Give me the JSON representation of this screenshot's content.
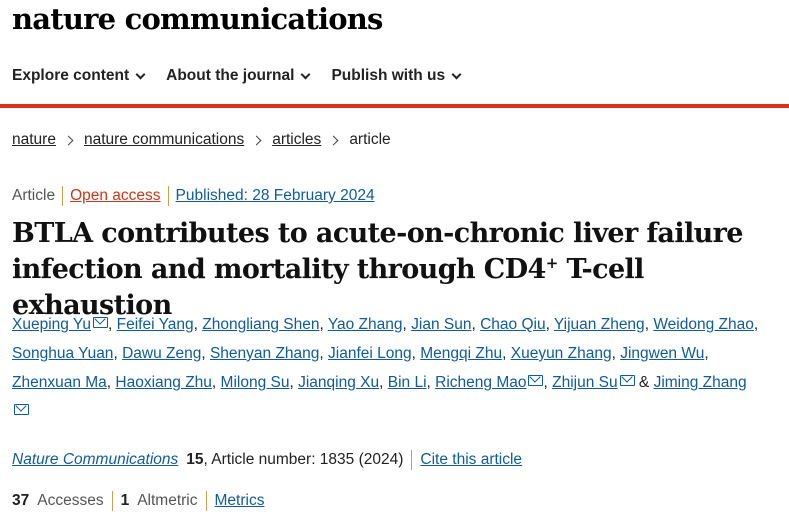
{
  "masthead": "nature communications",
  "nav": [
    {
      "label": "Explore content"
    },
    {
      "label": "About the journal"
    },
    {
      "label": "Publish with us"
    }
  ],
  "breadcrumb": [
    "nature",
    "nature communications",
    "articles",
    "article"
  ],
  "meta": {
    "type": "Article",
    "access": "Open access",
    "published": "Published: 28 February 2024"
  },
  "title": {
    "part1": "BTLA contributes to acute-on-chronic liver failure infection and mortality through CD4",
    "sup": "+",
    "part2": " T-cell exhaustion"
  },
  "authors": [
    "Xueping Yu",
    "Feifei Yang",
    "Zhongliang Shen",
    "Yao Zhang",
    "Jian Sun",
    "Chao Qiu",
    "Yijuan Zheng",
    "Weidong Zhao",
    "Songhua Yuan",
    "Dawu Zeng",
    "Shenyan Zhang",
    "Jianfei Long",
    "Mengqi Zhu",
    "Xueyun Zhang",
    "Jingwen Wu",
    "Zhenxuan Ma",
    "Haoxiang Zhu",
    "Milong Su",
    "Jianqing Xu",
    "Bin Li",
    "Richeng Mao",
    "Zhijun Su",
    "Jiming Zhang"
  ],
  "authors_joiner": "&",
  "citation": {
    "journal": "Nature Communications",
    "volume": "15",
    "article_number": ", Article number: 1835 (2024)",
    "cite_label": "Cite this article"
  },
  "metrics": {
    "accesses_count": "37",
    "accesses_label": "Accesses",
    "altmetric_count": "1",
    "altmetric_label": "Altmetric",
    "metrics_label": "Metrics"
  },
  "colors": {
    "accent_red": "#e0301e",
    "link_blue": "#0f5b9c",
    "divider_gold": "#c8a14f"
  }
}
